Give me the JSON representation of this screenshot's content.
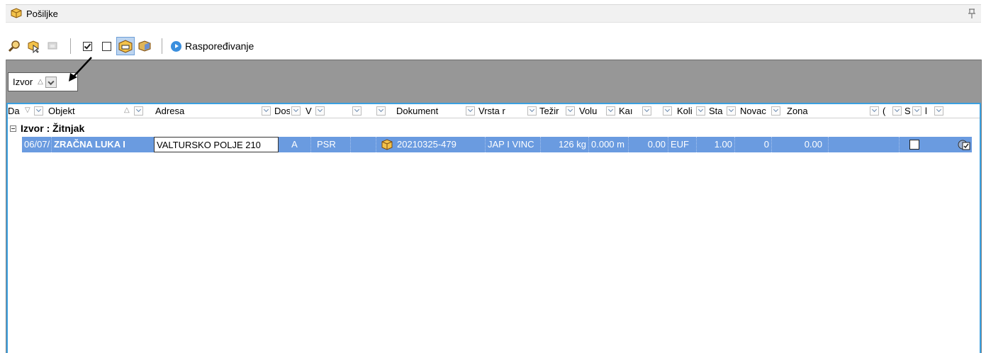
{
  "window": {
    "title": "Pošiljke",
    "pin_icon": "pin-icon"
  },
  "toolbar": {
    "schedule_label": "Raspoređivanje",
    "checkbox_all_checked": true,
    "checkbox_none_checked": false
  },
  "group_panel": {
    "chip_label": "Izvor"
  },
  "columns": [
    {
      "label": "Da"
    },
    {
      "label": "Objekt"
    },
    {
      "label": "Adresa"
    },
    {
      "label": "Dos"
    },
    {
      "label": "V"
    },
    {
      "label": ""
    },
    {
      "label": ""
    },
    {
      "label": "Dokument"
    },
    {
      "label": "Vrsta r"
    },
    {
      "label": "Težir"
    },
    {
      "label": "Volu"
    },
    {
      "label": "Kaı"
    },
    {
      "label": ""
    },
    {
      "label": "Koli"
    },
    {
      "label": "Sta"
    },
    {
      "label": "Novac"
    },
    {
      "label": "Zona"
    },
    {
      "label": "("
    },
    {
      "label": "S"
    },
    {
      "label": "l"
    }
  ],
  "group": {
    "label": "Izvor : Žitnjak"
  },
  "rows": [
    {
      "date": "06/07/",
      "object": "ZRAČNA LUKA I",
      "address": "VALTURSKO POLJE 210",
      "dos": "A",
      "v": "PSR",
      "document": "20210325-479",
      "vrsta": "JAP I VINC",
      "tezina": "126 kg",
      "volumen": "0.000 m",
      "kap": "0.00",
      "cur": "EUF",
      "koli": "1.00",
      "sta": "0",
      "novac": "0.00",
      "zona": "",
      "checked": false
    }
  ],
  "colors": {
    "accent": "#3aa0e0",
    "selected_row": "#6a9be0",
    "group_panel": "#979797"
  }
}
